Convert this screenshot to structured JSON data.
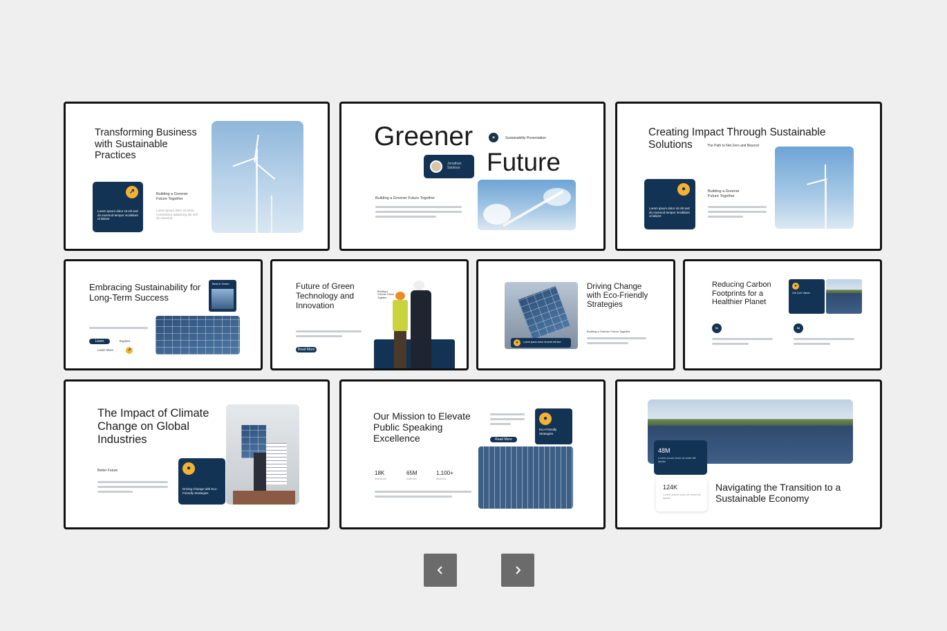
{
  "slides": {
    "s1": {
      "title": "Transforming Business with Sustainable Practices",
      "card_text": "Lorem ipsum dolor sit elit sed do eiusmod tempor incididunt ut labore",
      "side_title": "Building a Greener Future Together",
      "side_text": "Lorem ipsum dolor sit amet consectetur adipiscing elit sed do eiusmod"
    },
    "s2": {
      "title_a": "Greener",
      "title_b": "Future",
      "tag": "Sustainability Presentation",
      "name": "Jonathan Santoso",
      "sub": "Building a Greener Future Together"
    },
    "s3": {
      "title": "Creating Impact Through Sustainable Solutions",
      "tag": "The Path to Net Zero and Beyond",
      "side_title": "Building a Greener Future Together",
      "card_text": "Lorem ipsum dolor sit elit sed do eiusmod tempor incididunt ut labore"
    },
    "s4": {
      "title": "Embracing Sustainability for Long-Term Success",
      "badge": "Best in Green",
      "btn1": "Learn",
      "btn2": "Explore",
      "btn3": "Learn More"
    },
    "s5": {
      "title": "Future of Green Technology and Innovation",
      "small": "Building a Greener Future Together",
      "btn": "Read More"
    },
    "s6": {
      "title": "Driving Change with Eco-Friendly Strategies",
      "quote": "Lorem ipsum dolor sit amet elit sed",
      "side_title": "Building a Greener Future Together"
    },
    "s7": {
      "title": "Reducing Carbon Footprints for a Healthier Planet",
      "card_title": "Our Core Values",
      "n1": "01",
      "n2": "02"
    },
    "s8": {
      "title": "The Impact of Climate Change on Global Industries",
      "label": "Better Future",
      "card_text": "Driving Change with Eco-Friendly Strategies"
    },
    "s9": {
      "title": "Our Mission to Elevate Public Speaking Excellence",
      "btn": "Read More",
      "card_text": "Eco-Friendly Strategies",
      "stat1": "18K",
      "stat1_label": "Shipments",
      "stat2": "65M",
      "stat2_label": "Audience",
      "stat3": "1,100+",
      "stat3_label": "Students"
    },
    "s10": {
      "title": "Navigating the Transition to a Sustainable Economy",
      "stat1": "48M",
      "stat1_text": "Lorem ipsum dolor sit amet elit iaculis",
      "stat2": "124K",
      "stat2_text": "Lorem ipsum dolor sit amet elit iaculis"
    }
  },
  "nav": {
    "prev_icon": "chevron-left-icon",
    "next_icon": "chevron-right-icon"
  },
  "colors": {
    "navy": "#133354",
    "gold": "#f2b233",
    "background": "#efefef"
  }
}
